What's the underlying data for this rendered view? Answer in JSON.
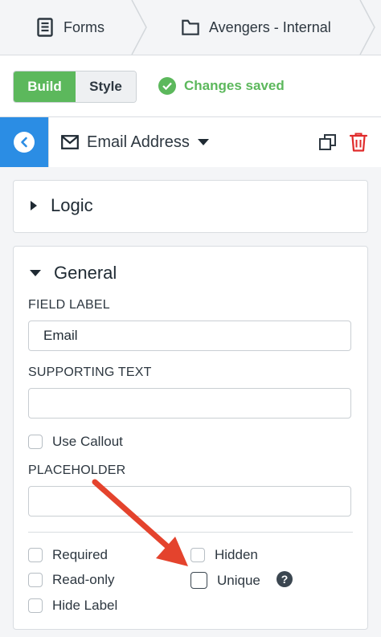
{
  "breadcrumb": {
    "items": [
      {
        "label": "Forms",
        "icon": "document-icon"
      },
      {
        "label": "Avengers - Internal",
        "icon": "folder-icon"
      }
    ]
  },
  "toolbar": {
    "build_label": "Build",
    "style_label": "Style",
    "status": "Changes saved",
    "accent_green": "#5cb85c"
  },
  "field": {
    "name": "Email Address",
    "icon": "envelope-icon",
    "back_color": "#2b8de4"
  },
  "logic": {
    "title": "Logic"
  },
  "general": {
    "title": "General",
    "field_label": {
      "label": "FIELD LABEL",
      "value": "Email"
    },
    "supporting_text": {
      "label": "SUPPORTING TEXT",
      "value": ""
    },
    "use_callout": "Use Callout",
    "placeholder": {
      "label": "PLACEHOLDER",
      "value": ""
    },
    "options": {
      "required": "Required",
      "hidden": "Hidden",
      "read_only": "Read-only",
      "unique": "Unique",
      "hide_label": "Hide Label",
      "help": "?"
    }
  },
  "annotation": {
    "arrow_color": "#e4432d"
  }
}
